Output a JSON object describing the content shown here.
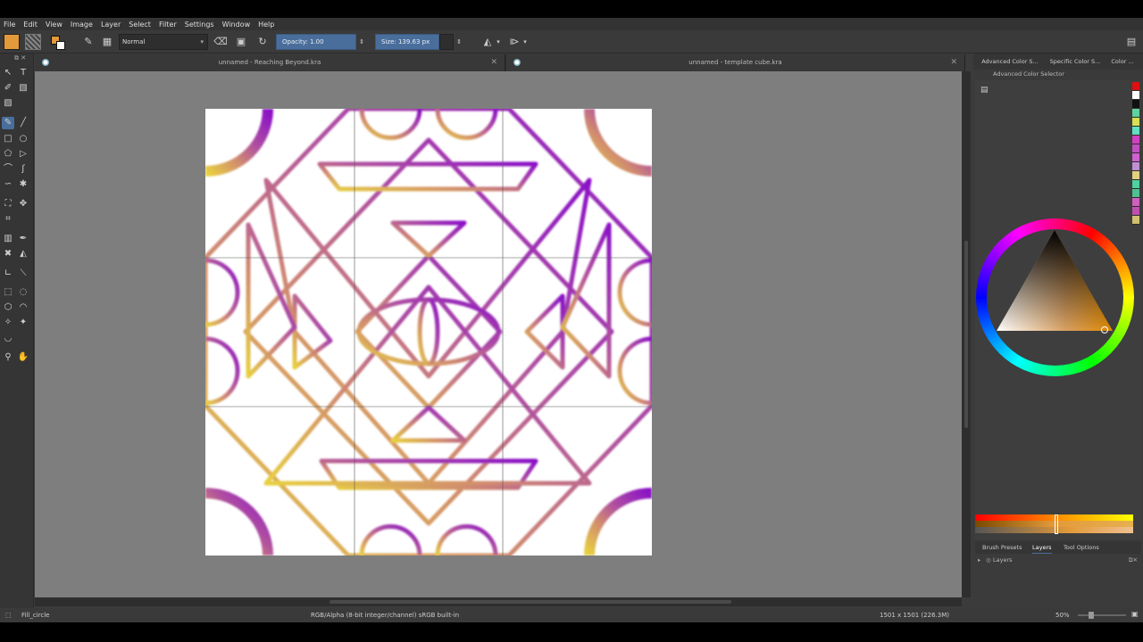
{
  "menu": [
    "File",
    "Edit",
    "View",
    "Image",
    "Layer",
    "Select",
    "Filter",
    "Settings",
    "Window",
    "Help"
  ],
  "toolbar": {
    "blend_mode": "Normal",
    "opacity_label": "Opacity: 1.00",
    "size_label": "Size: 139.63 px",
    "fg_color": "#e39a3a",
    "bg_color": "#ffffff"
  },
  "tabs": [
    {
      "title": "unnamed - Reaching Beyond.kra"
    },
    {
      "title": "unnamed - template cube.kra"
    }
  ],
  "right_panel": {
    "tabs": [
      "Advanced Color S...",
      "Specific Color S...",
      "Color ..."
    ],
    "header": "Advanced Color Selector",
    "history_colors": [
      "#e01010",
      "#ffffff",
      "#111111",
      "#5fd0a0",
      "#d6e050",
      "#60e0c0",
      "#d040c0",
      "#c050c0",
      "#d060d0",
      "#c090d0",
      "#e0d080",
      "#50d0a0",
      "#50c090",
      "#d060c0",
      "#c050b0",
      "#d0c070"
    ],
    "selected_color": "#e39a3a"
  },
  "dock2": {
    "tabs": [
      "Brush Presets",
      "Layers",
      "Tool Options"
    ],
    "active_tab": "Layers",
    "row_label": "Layers"
  },
  "status": {
    "tool": "Fill_circle",
    "color_space": "RGB/Alpha (8-bit integer/channel)  sRGB built-in",
    "image_size": "1501 x 1501 (226.3M)",
    "zoom": "50%"
  },
  "icons": {
    "tools": [
      "freehand-select-icon",
      "text-icon",
      "brush-icon",
      "line-icon",
      "rectangle-icon",
      "ellipse-icon",
      "polygon-icon",
      "polyline-icon",
      "bezier-icon",
      "freehand-path-icon",
      "dynamic-brush-icon",
      "multibrush-icon",
      "transform-icon",
      "move-icon",
      "crop-icon",
      "gradient-icon",
      "color-picker-icon",
      "smart-patch-icon",
      "fill-icon",
      "assistant-icon",
      "measure-icon",
      "rect-select-icon",
      "ellipse-select-icon",
      "polygon-select-icon",
      "outline-select-icon",
      "contiguous-select-icon",
      "similar-select-icon",
      "bezier-select-icon",
      "zoom-icon",
      "pan-icon"
    ]
  }
}
